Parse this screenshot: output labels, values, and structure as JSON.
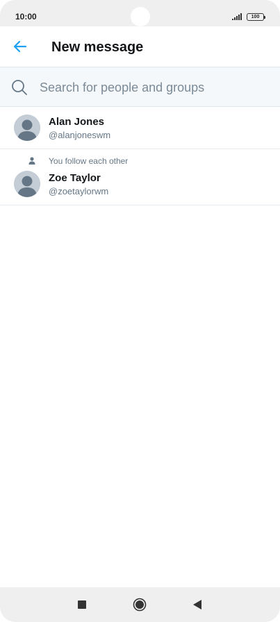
{
  "status_bar": {
    "time": "10:00",
    "battery": "100",
    "icons": [
      "signal-icon",
      "battery-icon"
    ]
  },
  "header": {
    "title": "New message",
    "back_icon": "arrow-left-icon",
    "accent_color": "#1da1f2"
  },
  "search": {
    "placeholder": "Search for people and groups",
    "value": "",
    "icon": "search-icon"
  },
  "contacts": [
    {
      "name": "Alan Jones",
      "handle": "@alanjoneswm",
      "note": "",
      "avatar": "default-avatar-icon"
    },
    {
      "name": "Zoe Taylor",
      "handle": "@zoetaylorwm",
      "note": "You follow each other",
      "note_icon": "person-icon",
      "avatar": "default-avatar-icon"
    }
  ],
  "nav_bar": {
    "buttons": [
      "recent-apps-icon",
      "home-icon",
      "back-triangle-icon"
    ]
  }
}
